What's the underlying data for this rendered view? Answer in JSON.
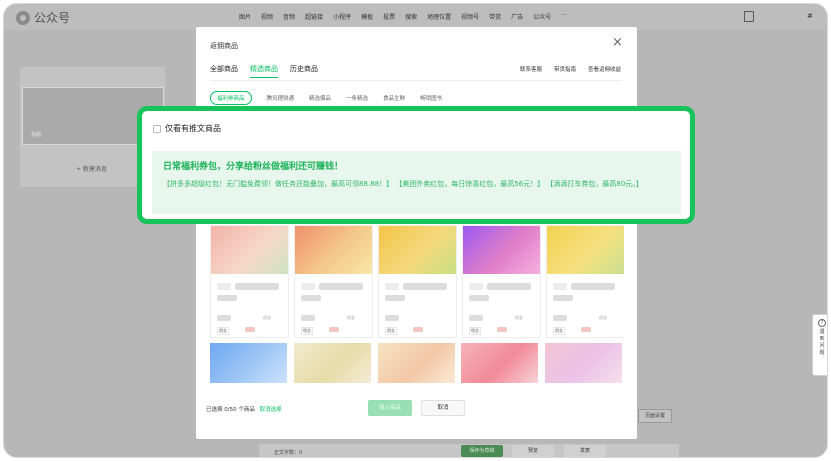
{
  "app": {
    "name": "公众号"
  },
  "topnav": {
    "items": [
      {
        "label": "图片",
        "dot": true
      },
      {
        "label": "视频",
        "dot": false
      },
      {
        "label": "音频",
        "dot": false
      },
      {
        "label": "超链接",
        "dot": false
      },
      {
        "label": "小程序",
        "dot": false
      },
      {
        "label": "模板",
        "dot": false
      },
      {
        "label": "投票",
        "dot": false
      },
      {
        "label": "搜索",
        "dot": false
      },
      {
        "label": "地理位置",
        "dot": false
      },
      {
        "label": "视频号",
        "dot": false
      },
      {
        "label": "带货",
        "dot": false
      },
      {
        "label": "广告",
        "dot": false
      },
      {
        "label": "公众号",
        "dot": true
      }
    ],
    "more": "···",
    "hash": "#"
  },
  "background": {
    "new_message": "+ 新建消息",
    "card_label": "标题",
    "word_count": "正文字数：0",
    "save_button": "保存为草稿",
    "preview_button": "预览",
    "publish_button": "发表",
    "right_button": "页面设置",
    "help_text": "遇到问题",
    "help_icon": "?"
  },
  "modal": {
    "title": "返佣商品",
    "close": "×",
    "tabs": [
      {
        "label": "全部商品",
        "active": false
      },
      {
        "label": "精选商品",
        "active": true
      },
      {
        "label": "历史商品",
        "active": false
      }
    ],
    "links": [
      "联系客服",
      "带货指南",
      "查看返佣收益"
    ],
    "chips": [
      {
        "label": "福利券商品",
        "active": true
      },
      {
        "label": "腾讯理财通",
        "active": false
      },
      {
        "label": "精选爆品",
        "active": false
      },
      {
        "label": "一条精选",
        "active": false
      },
      {
        "label": "食品生鲜",
        "active": false
      },
      {
        "label": "畅销图书",
        "active": false
      }
    ],
    "products_row1": [
      {
        "tag": "佣金",
        "right": "佣金",
        "colors": [
          "#f3b1a8",
          "#f6d7c7",
          "#cfe3c0"
        ]
      },
      {
        "tag": "佣金",
        "right": "佣金",
        "colors": [
          "#f08f6e",
          "#f4c98a",
          "#f7e7a7"
        ]
      },
      {
        "tag": "佣金",
        "right": "",
        "colors": [
          "#f4c446",
          "#f5d97d",
          "#c7df83"
        ]
      },
      {
        "tag": "佣金",
        "right": "佣金",
        "colors": [
          "#9c59f1",
          "#e17ec8",
          "#f5b1e0"
        ]
      },
      {
        "tag": "佣金",
        "right": "佣金",
        "colors": [
          "#f2d14f",
          "#f6e07f",
          "#c9df8f"
        ]
      }
    ],
    "products_row2": [
      {
        "colors": [
          "#6fa8f2",
          "#9ec7f5",
          "#cfe2fb"
        ]
      },
      {
        "colors": [
          "#f1ead0",
          "#e6dba7",
          "#f5ecd8"
        ]
      },
      {
        "colors": [
          "#f6e4c3",
          "#f2c7a6",
          "#fbe9d6"
        ]
      },
      {
        "colors": [
          "#f4b3b9",
          "#f28a98",
          "#f6d3d7"
        ]
      },
      {
        "colors": [
          "#f3c5d4",
          "#ebc2e8",
          "#f6e0ea"
        ]
      }
    ],
    "selected_info": "已选择 0/50 个商品",
    "deselect": "取消选择",
    "insert_button": "插入商品",
    "cancel_button": "取消"
  },
  "highlight": {
    "checkbox_label": "仅看有推文商品",
    "banner_title": "日常福利券包，分享给粉丝做福利还可赚钱！",
    "banner_desc": "【拼多多超级红包！无门槛免费领！做任务还能叠加，最高可领88.88！】 【美团外卖红包，每日惊喜红包，最高56元！】 【滴滴打车券包，最高80元。】"
  },
  "colors": {
    "accent": "#07c160",
    "highlight_border": "#17c35b",
    "banner_bg": "#e8f7ee"
  }
}
